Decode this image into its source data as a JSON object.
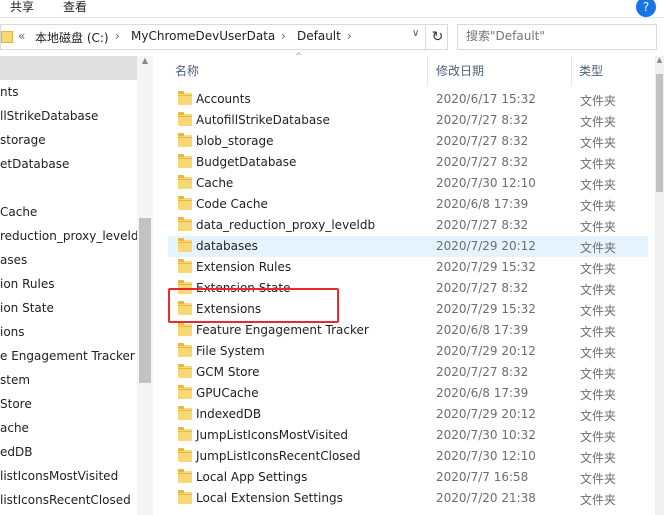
{
  "ribbon": {
    "tabs": [
      "共享",
      "查看"
    ]
  },
  "address": {
    "overflow": "«",
    "crumbs": [
      "本地磁盘 (C:)",
      "MyChromeDevUserData",
      "Default"
    ],
    "sep": "›",
    "dropdown": "∨",
    "refresh": "↻"
  },
  "search": {
    "placeholder": "搜索\"Default\""
  },
  "nav": {
    "items": [
      "",
      "nts",
      "llStrikeDatabase",
      "storage",
      "etDatabase",
      "",
      "Cache",
      "reduction_proxy_leveldb",
      "ases",
      "ion Rules",
      "ion State",
      "ions",
      "e Engagement Tracker",
      "stem",
      "Store",
      "ache",
      "edDB",
      "listIconsMostVisited",
      "listIconsRecentClosed"
    ]
  },
  "columns": {
    "name": "名称",
    "date": "修改日期",
    "type": "类型"
  },
  "files": [
    {
      "name": "Accounts",
      "date": "2020/6/17 15:32",
      "type": "文件夹"
    },
    {
      "name": "AutofillStrikeDatabase",
      "date": "2020/7/27 8:32",
      "type": "文件夹"
    },
    {
      "name": "blob_storage",
      "date": "2020/7/27 8:32",
      "type": "文件夹"
    },
    {
      "name": "BudgetDatabase",
      "date": "2020/7/27 8:32",
      "type": "文件夹"
    },
    {
      "name": "Cache",
      "date": "2020/7/30 12:10",
      "type": "文件夹"
    },
    {
      "name": "Code Cache",
      "date": "2020/6/8 17:39",
      "type": "文件夹"
    },
    {
      "name": "data_reduction_proxy_leveldb",
      "date": "2020/7/27 8:32",
      "type": "文件夹"
    },
    {
      "name": "databases",
      "date": "2020/7/29 20:12",
      "type": "文件夹"
    },
    {
      "name": "Extension Rules",
      "date": "2020/7/29 15:32",
      "type": "文件夹"
    },
    {
      "name": "Extension State",
      "date": "2020/7/27 8:32",
      "type": "文件夹"
    },
    {
      "name": "Extensions",
      "date": "2020/7/29 15:32",
      "type": "文件夹"
    },
    {
      "name": "Feature Engagement Tracker",
      "date": "2020/6/8 17:39",
      "type": "文件夹"
    },
    {
      "name": "File System",
      "date": "2020/7/29 20:12",
      "type": "文件夹"
    },
    {
      "name": "GCM Store",
      "date": "2020/7/27 8:32",
      "type": "文件夹"
    },
    {
      "name": "GPUCache",
      "date": "2020/6/8 17:39",
      "type": "文件夹"
    },
    {
      "name": "IndexedDB",
      "date": "2020/7/29 20:12",
      "type": "文件夹"
    },
    {
      "name": "JumpListIconsMostVisited",
      "date": "2020/7/30 10:32",
      "type": "文件夹"
    },
    {
      "name": "JumpListIconsRecentClosed",
      "date": "2020/7/30 12:10",
      "type": "文件夹"
    },
    {
      "name": "Local App Settings",
      "date": "2020/7/7 16:58",
      "type": "文件夹"
    },
    {
      "name": "Local Extension Settings",
      "date": "2020/7/20 21:38",
      "type": "文件夹"
    }
  ],
  "colors": {
    "hover_row": "#e5f3ff",
    "highlight": "#e52b2b",
    "folder": "#f8d775"
  },
  "icons": {
    "folder": "folder-icon",
    "help": "help-icon",
    "refresh": "refresh-icon"
  }
}
